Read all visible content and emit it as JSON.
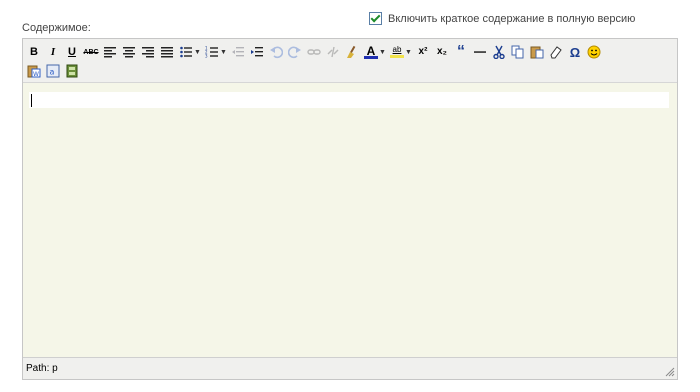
{
  "form": {
    "content_label": "Содержимое:",
    "include_summary_label": "Включить краткое содержание в полную версию",
    "include_summary_checked": true
  },
  "editor": {
    "toolbar": {
      "bold": "B",
      "italic": "I",
      "underline": "U",
      "strikethrough": "ABC",
      "superscript": "x²",
      "subscript": "x₂",
      "quote": "“",
      "omega": "Ω",
      "text_color_glyph": "A",
      "highlight_glyph": "ab",
      "dropdown_glyph": "▼"
    },
    "status_path": "Path: p"
  },
  "colors": {
    "text_color_bar": "#1f2fb0",
    "highlight_bar": "#f2e34b",
    "smiley": "#ffd200",
    "toolbar_bg": "#f0f0ee",
    "content_bg": "#f5f6e8"
  }
}
